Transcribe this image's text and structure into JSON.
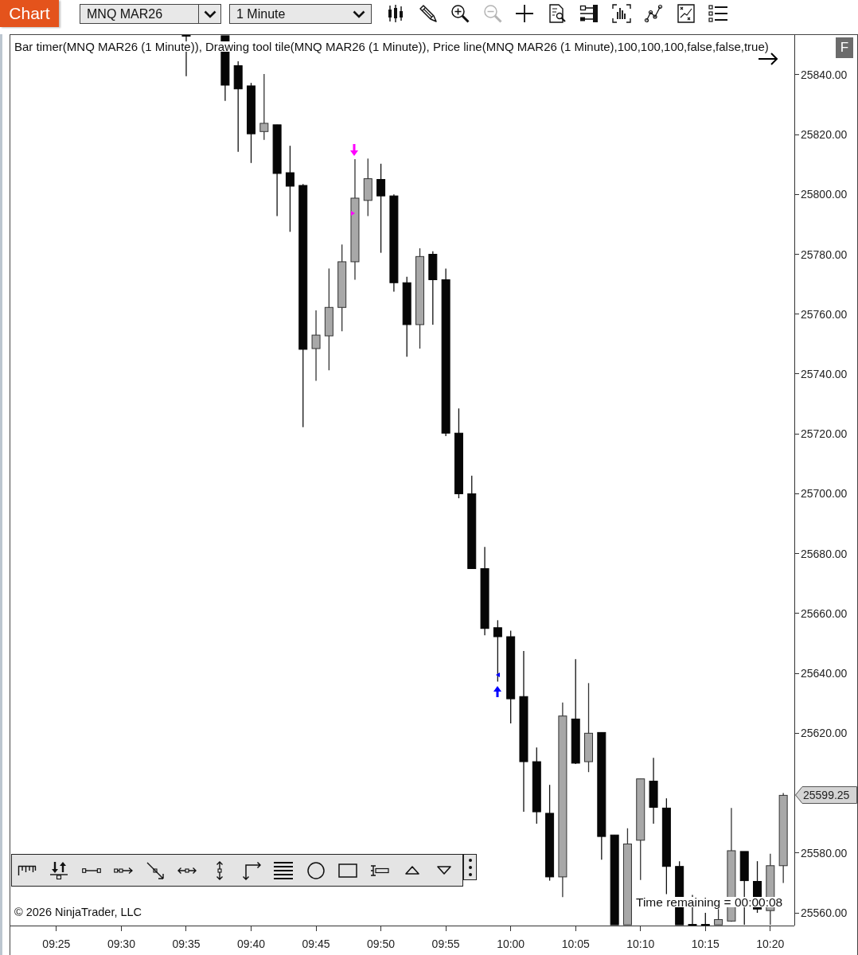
{
  "tab": {
    "label": "Chart"
  },
  "instrument": {
    "value": "MNQ MAR26"
  },
  "interval": {
    "value": "1 Minute"
  },
  "toolbar": [
    {
      "disabled": false
    },
    {
      "disabled": false
    },
    {
      "disabled": false
    },
    {
      "disabled": true
    },
    {
      "disabled": false
    },
    {
      "disabled": false
    },
    {
      "disabled": false
    },
    {
      "disabled": false
    },
    {
      "disabled": false
    },
    {
      "disabled": false
    },
    {
      "disabled": false
    }
  ],
  "chart": {
    "legend": "Bar timer(MNQ MAR26 (1 Minute)), Drawing tool tile(MNQ MAR26 (1 Minute)), Price line(MNQ MAR26 (1 Minute),100,100,100,false,false,true)",
    "corner_button": "F",
    "last_price_tag": "25599.25",
    "copyright": "© 2026 NinjaTrader, LLC",
    "time_remaining": "Time remaining = 00:00:08",
    "chart_data": {
      "type": "candlestick",
      "x": [
        575,
        578,
        579,
        580,
        581,
        582,
        583,
        584,
        585,
        586,
        587,
        588,
        589,
        590,
        591,
        592,
        593,
        594,
        595,
        596,
        597,
        598,
        599,
        600,
        601,
        602,
        603,
        604,
        605,
        606,
        607,
        608,
        609,
        610,
        611,
        612,
        613,
        614,
        615,
        616,
        617,
        618,
        619,
        620,
        621
      ],
      "ohlc": [
        [
          25853.0,
          25853.0,
          25839.5,
          25853.0
        ],
        [
          25853.0,
          25853.0,
          25831.25,
          25836.5
        ],
        [
          25843.0,
          25844.5,
          25814.25,
          25835.25
        ],
        [
          25836.25,
          25837.25,
          25810.5,
          25820.25
        ],
        [
          25821.0,
          25840.25,
          25818.25,
          25823.75
        ],
        [
          25823.25,
          25823.25,
          25792.75,
          25807.0
        ],
        [
          25807.25,
          25816.25,
          25787.5,
          25802.75
        ],
        [
          25803.0,
          25803.5,
          25722.25,
          25748.25
        ],
        [
          25748.5,
          25761.25,
          25737.75,
          25753.0
        ],
        [
          25752.75,
          25775.25,
          25741.25,
          25762.25
        ],
        [
          25762.25,
          25783.25,
          25754.25,
          25777.5
        ],
        [
          25777.5,
          25811.75,
          25771.5,
          25798.75
        ],
        [
          25798.0,
          25812.0,
          25792.75,
          25805.25
        ],
        [
          25805.0,
          25810.25,
          25780.5,
          25799.5
        ],
        [
          25799.5,
          25800.0,
          25767.5,
          25770.5
        ],
        [
          25770.5,
          25772.5,
          25745.75,
          25756.5
        ],
        [
          25756.5,
          25782.0,
          25748.5,
          25779.25
        ],
        [
          25780.0,
          25781.0,
          25756.5,
          25771.5
        ],
        [
          25771.5,
          25775.25,
          25719.25,
          25720.25
        ],
        [
          25720.25,
          25728.5,
          25698.5,
          25700.0
        ],
        [
          25700.0,
          25706.0,
          25675.0,
          25675.0
        ],
        [
          25675.0,
          25682.25,
          25652.75,
          25655.0
        ],
        [
          25655.25,
          25657.75,
          25637.25,
          25652.25
        ],
        [
          25652.25,
          25654.25,
          25623.25,
          25631.5
        ],
        [
          25632.25,
          25647.5,
          25593.75,
          25610.5
        ],
        [
          25610.5,
          25615.25,
          25589.75,
          25593.75
        ],
        [
          25593.25,
          25602.75,
          25570.75,
          25572.0
        ],
        [
          25572.0,
          25630.25,
          25565.25,
          25625.75
        ],
        [
          25624.75,
          25644.75,
          25609.75,
          25610.0
        ],
        [
          25610.5,
          25636.75,
          25607.0,
          25620.0
        ],
        [
          25620.25,
          25620.25,
          25577.75,
          25585.5
        ],
        [
          25586.0,
          25586.0,
          25556.0,
          25556.0
        ],
        [
          25556.0,
          25588.25,
          25556.0,
          25583.0
        ],
        [
          25584.25,
          25604.75,
          25571.0,
          25604.75
        ],
        [
          25604.0,
          25611.75,
          25589.75,
          25595.25
        ],
        [
          25595.0,
          25598.25,
          25566.25,
          25575.5
        ],
        [
          25575.5,
          25577.25,
          25556.0,
          25556.0
        ],
        [
          25556.0,
          25566.0,
          25556.0,
          25556.0
        ],
        [
          25556.0,
          25560.0,
          25556.0,
          25556.0
        ],
        [
          25556.0,
          25561.25,
          25556.0,
          25557.75
        ],
        [
          25557.25,
          25595.0,
          25557.0,
          25580.75
        ],
        [
          25580.5,
          25580.5,
          25556.0,
          25570.75
        ],
        [
          25570.5,
          25577.25,
          25560.0,
          25561.25
        ],
        [
          25560.75,
          25579.75,
          25556.0,
          25575.75
        ],
        [
          25575.75,
          25600.0,
          25570.0,
          25599.25
        ]
      ],
      "xlim": [
        561.45,
        621.85
      ],
      "ylim": [
        25555.75,
        25853.25
      ],
      "xticks": [
        {
          "value": 565,
          "label": "09:25"
        },
        {
          "value": 570,
          "label": "09:30"
        },
        {
          "value": 575,
          "label": "09:35"
        },
        {
          "value": 580,
          "label": "09:40"
        },
        {
          "value": 585,
          "label": "09:45"
        },
        {
          "value": 590,
          "label": "09:50"
        },
        {
          "value": 595,
          "label": "09:55"
        },
        {
          "value": 600,
          "label": "10:00"
        },
        {
          "value": 605,
          "label": "10:05"
        },
        {
          "value": 610,
          "label": "10:10"
        },
        {
          "value": 615,
          "label": "10:15"
        },
        {
          "value": 620,
          "label": "10:20"
        }
      ],
      "yticks": [
        {
          "value": 25840,
          "label": "25840.00"
        },
        {
          "value": 25820,
          "label": "25820.00"
        },
        {
          "value": 25800,
          "label": "25800.00"
        },
        {
          "value": 25780,
          "label": "25780.00"
        },
        {
          "value": 25760,
          "label": "25760.00"
        },
        {
          "value": 25740,
          "label": "25740.00"
        },
        {
          "value": 25720,
          "label": "25720.00"
        },
        {
          "value": 25700,
          "label": "25700.00"
        },
        {
          "value": 25680,
          "label": "25680.00"
        },
        {
          "value": 25660,
          "label": "25660.00"
        },
        {
          "value": 25640,
          "label": "25640.00"
        },
        {
          "value": 25620,
          "label": "25620.00"
        },
        {
          "value": 25580,
          "label": "25580.00"
        },
        {
          "value": 25560,
          "label": "25560.00"
        }
      ]
    }
  }
}
